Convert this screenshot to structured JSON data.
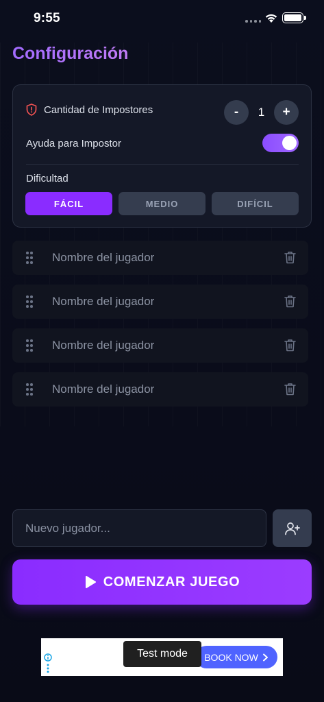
{
  "status_bar": {
    "time": "9:55"
  },
  "page": {
    "title": "Configuración"
  },
  "settings": {
    "impostors_label": "Cantidad de Impostores",
    "impostors_count": "1",
    "minus_label": "-",
    "plus_label": "+",
    "helper_label": "Ayuda para Impostor",
    "helper_enabled": true,
    "difficulty_label": "Dificultad",
    "difficulties": [
      "FÁCIL",
      "MEDIO",
      "DIFÍCIL"
    ],
    "selected_difficulty": "FÁCIL"
  },
  "players": [
    {
      "placeholder": "Nombre del jugador"
    },
    {
      "placeholder": "Nombre del jugador"
    },
    {
      "placeholder": "Nombre del jugador"
    },
    {
      "placeholder": "Nombre del jugador"
    }
  ],
  "new_player": {
    "placeholder": "Nuevo jugador..."
  },
  "start_button": {
    "label": "COMENZAR JUEGO"
  },
  "ad": {
    "cta": "BOOK NOW",
    "test_mode": "Test mode"
  },
  "colors": {
    "accent": "#8a2cff",
    "title_gradient_start": "#a26bff",
    "background": "#0a0d1c"
  },
  "icons": [
    "shield-icon",
    "drag-handle-icon",
    "trash-icon",
    "add-user-icon",
    "play-icon",
    "wifi-icon",
    "battery-icon",
    "info-icon",
    "chevron-right-icon"
  ]
}
